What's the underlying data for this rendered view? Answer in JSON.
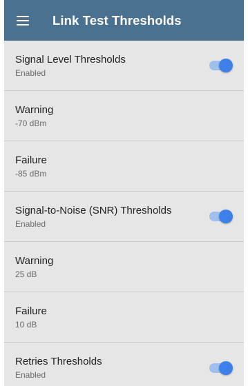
{
  "appbar": {
    "menu_icon": "hamburger-menu-icon",
    "title": "Link Test Thresholds",
    "color": "#4a7190"
  },
  "settings": [
    {
      "title": "Signal Level Thresholds",
      "subtitle": "Enabled",
      "has_toggle": true,
      "toggle_on": true
    },
    {
      "title": "Warning",
      "subtitle": "-70 dBm",
      "has_toggle": false
    },
    {
      "title": "Failure",
      "subtitle": "-85 dBm",
      "has_toggle": false
    },
    {
      "title": "Signal-to-Noise (SNR) Thresholds",
      "subtitle": "Enabled",
      "has_toggle": true,
      "toggle_on": true
    },
    {
      "title": "Warning",
      "subtitle": "25 dB",
      "has_toggle": false
    },
    {
      "title": "Failure",
      "subtitle": "10 dB",
      "has_toggle": false
    },
    {
      "title": "Retries Thresholds",
      "subtitle": "Enabled",
      "has_toggle": true,
      "toggle_on": true
    }
  ],
  "colors": {
    "list_background": "#e6e6e6",
    "toggle_thumb": "#3d80ea",
    "toggle_track": "#9fc0ec"
  }
}
